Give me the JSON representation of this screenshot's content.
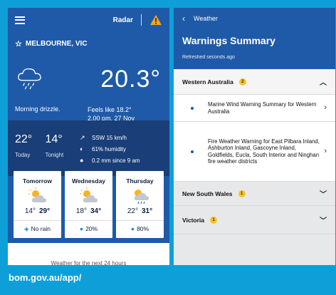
{
  "left_screen": {
    "header": {
      "radar_label": "Radar"
    },
    "location": "MELBOURNE, VIC",
    "current": {
      "temperature": "20.3°",
      "condition": "Morning drizzle.",
      "feels_like": "Feels like 18.2°",
      "datetime": "2.00 pm, 27 Nov"
    },
    "today": {
      "max": "22°",
      "min": "14°",
      "max_label": "Today",
      "min_label": "Tonight",
      "wind": "SSW 15 km/h",
      "humidity": "61% humidity",
      "rain": "0.2 mm since 9 am"
    },
    "forecast": [
      {
        "day": "Tomorrow",
        "min": "14°",
        "max": "29°",
        "rain": "No rain",
        "icon": "partly-cloudy-icon"
      },
      {
        "day": "Wednesday",
        "min": "18°",
        "max": "34°",
        "rain": "20%",
        "icon": "partly-cloudy-icon"
      },
      {
        "day": "Thursday",
        "min": "22°",
        "max": "31°",
        "rain": "80%",
        "icon": "showers-icon"
      }
    ],
    "footer_text": "Weather for the next 24 hours"
  },
  "right_screen": {
    "nav_label": "Weather",
    "title": "Warnings Summary",
    "refreshed": "Refreshed seconds ago",
    "regions": [
      {
        "name": "Western Australia",
        "count": "2",
        "warnings": [
          "Marine Wind Warning Summary for Western Australia",
          "Fire Weather Warning for East Pilbara Inland, Ashburton Inland, Gascoyne Inland, Goldfields, Eucla, South Interior and Ninghan fire weather districts"
        ]
      },
      {
        "name": "New South Wales",
        "count": "1"
      },
      {
        "name": "Victoria",
        "count": "1"
      }
    ]
  },
  "caption": "bom.gov.au/app/",
  "colors": {
    "background": "#0f9fd8",
    "app_blue": "#1e5aa8",
    "app_dark_blue": "#193e78",
    "badge_yellow": "#f6c328",
    "warning_orange": "#f5a21b"
  }
}
